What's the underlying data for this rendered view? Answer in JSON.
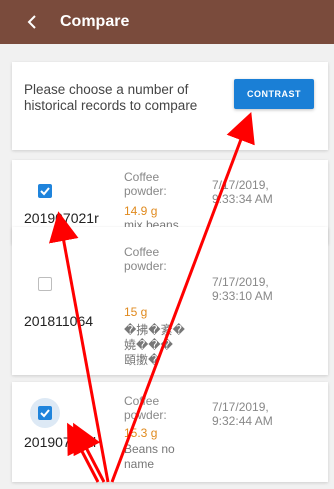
{
  "appbar": {
    "title": "Compare",
    "back_icon": "chevron-left-icon"
  },
  "prompt": {
    "text": "Please choose a number of historical records to compare",
    "button_label": "CONTRAST"
  },
  "records": [
    {
      "checked": true,
      "id": "201907021r",
      "label": "Coffee powder:",
      "weight": "14.9 g",
      "bean": "mix beans",
      "time": "7/17/2019, 9:33:34 AM"
    },
    {
      "checked": false,
      "id": "201811064",
      "label": "Coffee powder:",
      "weight": "15 g",
      "bean": "�拂�紊�\n嬈���\n頤擻�",
      "time": "7/17/2019, 9:33:10 AM"
    },
    {
      "checked": true,
      "id": "201907011l",
      "label": "Coffee powder:",
      "weight": "15.3 g",
      "bean": "Beans no name",
      "time": "7/17/2019, 9:32:44 AM"
    }
  ],
  "colors": {
    "appbar": "#7a4b3c",
    "accent": "#1f84dc",
    "weight": "#e08a1e",
    "annotation": "#ff0000"
  }
}
